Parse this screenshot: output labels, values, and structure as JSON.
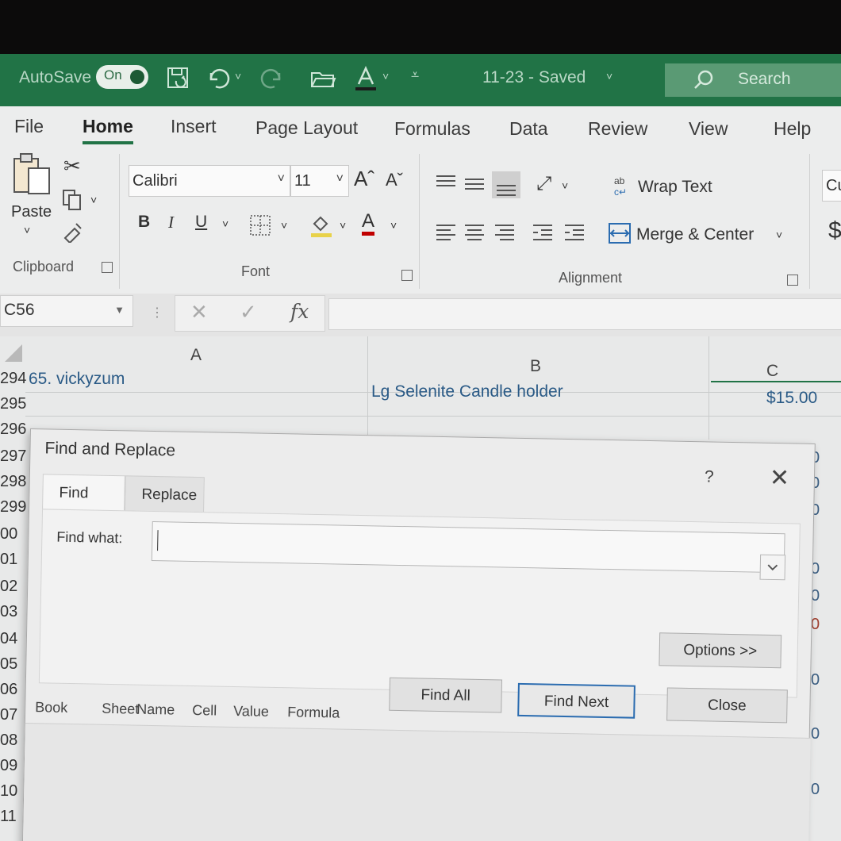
{
  "titlebar": {
    "autosave_label": "AutoSave",
    "autosave_state": "On",
    "document_title": "11-23  -  Saved",
    "title_chevron": "˅",
    "search_placeholder": "Search",
    "accent_color": "#217346"
  },
  "ribbon": {
    "tabs": [
      "File",
      "Home",
      "Insert",
      "Page Layout",
      "Formulas",
      "Data",
      "Review",
      "View",
      "Help"
    ],
    "active_tab": "Home",
    "clipboard": {
      "paste_label": "Paste",
      "group_label": "Clipboard"
    },
    "font": {
      "font_name": "Calibri",
      "font_size": "11",
      "bold": "B",
      "italic": "I",
      "underline": "U",
      "grow_font": "Aˆ",
      "shrink_font": "Aˇ",
      "font_color_glyph": "A",
      "group_label": "Font"
    },
    "alignment": {
      "wrap_text": "Wrap Text",
      "merge_center": "Merge & Center",
      "group_label": "Alignment"
    },
    "number": {
      "format_partial": "Cu",
      "currency_glyph": "$"
    }
  },
  "formula_bar": {
    "name_box": "C56",
    "cancel_glyph": "✕",
    "enter_glyph": "✓",
    "fx_label": "fx",
    "formula_value": ""
  },
  "sheet": {
    "columns": [
      "A",
      "B",
      "C"
    ],
    "rows": [
      {
        "num": "294",
        "a": "65. vickyzum",
        "b": "Lg Selenite Candle holder",
        "c": "$15.00"
      },
      {
        "num": "295"
      },
      {
        "num": "296"
      },
      {
        "num": "297"
      },
      {
        "num": "298"
      },
      {
        "num": "299"
      },
      {
        "num": "00"
      },
      {
        "num": "01"
      },
      {
        "num": "02"
      },
      {
        "num": "03"
      },
      {
        "num": "04"
      },
      {
        "num": "05"
      },
      {
        "num": "06"
      },
      {
        "num": "07"
      },
      {
        "num": "08"
      },
      {
        "num": "09"
      },
      {
        "num": "10"
      },
      {
        "num": "11"
      }
    ],
    "right_edge_digit": "0"
  },
  "find_replace": {
    "title": "Find and Replace",
    "help_glyph": "?",
    "close_glyph": "✕",
    "tabs": [
      "Find",
      "Replace"
    ],
    "active_tab": "Find",
    "find_what_label": "Find what:",
    "find_what_value": "",
    "options_button": "Options >>",
    "find_all_button": "Find All",
    "find_next_button": "Find Next",
    "close_button": "Close",
    "results_columns": [
      "Book",
      "Sheet",
      "Name",
      "Cell",
      "Value",
      "Formula"
    ]
  }
}
